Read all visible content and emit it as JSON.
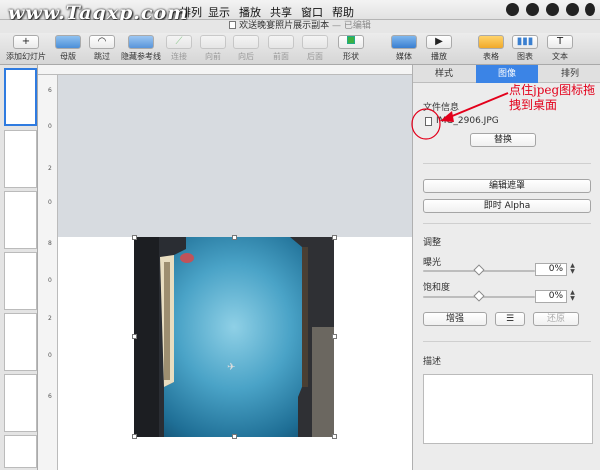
{
  "watermark": "www.Tagxp.com",
  "menubar": {
    "items": [
      "排列",
      "显示",
      "播放",
      "共享",
      "窗口",
      "帮助"
    ]
  },
  "titlebar": {
    "title": "欢送晚宴照片展示副本",
    "status": "— 已编辑"
  },
  "toolbar": {
    "add_slide": "添加幻灯片",
    "master": "母版",
    "skip": "跳过",
    "hide_guides": "隐藏参考线",
    "connect": "连接",
    "front": "向前",
    "back": "向后",
    "to_front": "前面",
    "to_back": "后面",
    "shape": "形状",
    "media": "媒体",
    "play": "播放",
    "table": "表格",
    "chart": "图表",
    "text": "文本"
  },
  "ruler": {
    "left_labels": [
      "6",
      "0",
      "2",
      "0",
      "8",
      "0",
      "2",
      "0",
      "6"
    ]
  },
  "inspector": {
    "tabs": [
      "样式",
      "图像",
      "排列"
    ],
    "file_info_label": "文件信息",
    "file_name": "IMG_2906.JPG",
    "replace_button": "替换",
    "edit_mask_button": "编辑遮罩",
    "instant_alpha_button": "即时 Alpha",
    "adjust_label": "调整",
    "exposure_label": "曝光",
    "exposure_value": "0%",
    "exposure_level": 0.5,
    "saturation_label": "饱和度",
    "saturation_value": "0%",
    "saturation_level": 0.5,
    "enhance_button": "增强",
    "reset_button": "还原",
    "description_label": "描述"
  },
  "annotation": {
    "line1": "点住jpeg图标拖",
    "line2": "拽到桌面",
    "color": "#e3001b"
  },
  "colors": {
    "accent": "#3b84e6"
  }
}
